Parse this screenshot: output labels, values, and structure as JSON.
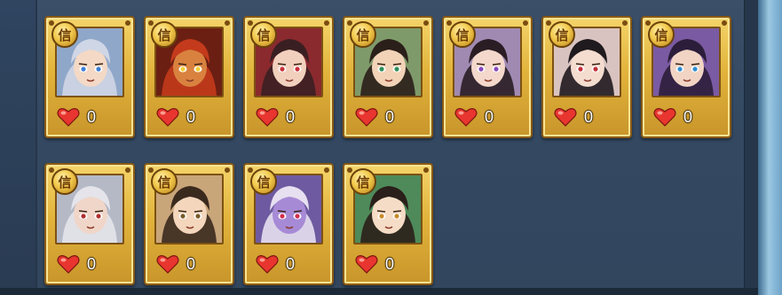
{
  "accent_gold": "#e2b43c",
  "heart_color": "#e8352f",
  "cards": [
    {
      "badge": "信",
      "hair": "#cfd6e6",
      "skin": "#f3d9c6",
      "eyes": "#3f7fd6",
      "bg": "#8fa7c9",
      "count": "0",
      "icon": "white-haired-warrior-portrait"
    },
    {
      "badge": "信",
      "hair": "#c43a1c",
      "skin": "#d9823f",
      "eyes": "#f2d13a",
      "bg": "#6b1f12",
      "count": "0",
      "icon": "red-bearded-warrior-portrait"
    },
    {
      "badge": "信",
      "hair": "#3a1f22",
      "skin": "#f1d0bd",
      "eyes": "#c8323a",
      "bg": "#8a2a2e",
      "count": "0",
      "icon": "red-armored-general-portrait"
    },
    {
      "badge": "信",
      "hair": "#2b1f1a",
      "skin": "#f2d3b8",
      "eyes": "#2f8f5a",
      "bg": "#7f9a6a",
      "count": "0",
      "icon": "dark-haired-woman-portrait"
    },
    {
      "badge": "信",
      "hair": "#2a1d24",
      "skin": "#f3d8cb",
      "eyes": "#8a4bbd",
      "bg": "#a08ab2",
      "count": "0",
      "icon": "circlet-woman-portrait"
    },
    {
      "badge": "信",
      "hair": "#1f1a1e",
      "skin": "#f4dccf",
      "eyes": "#c2303a",
      "bg": "#d9c3c0",
      "count": "0",
      "icon": "crowned-youth-portrait"
    },
    {
      "badge": "信",
      "hair": "#2c1d3a",
      "skin": "#f1d4c4",
      "eyes": "#2f8fd0",
      "bg": "#7a5aa2",
      "count": "0",
      "icon": "purple-helmed-hero-portrait"
    },
    {
      "badge": "信",
      "hair": "#e4e4ea",
      "skin": "#f0d6c8",
      "eyes": "#b03030",
      "bg": "#b5b9c6",
      "count": "0",
      "icon": "silver-haired-sage-portrait"
    },
    {
      "badge": "信",
      "hair": "#3a2a1e",
      "skin": "#f3d6bc",
      "eyes": "#7a5a2a",
      "bg": "#c9a57a",
      "count": "0",
      "icon": "scholar-portrait"
    },
    {
      "badge": "信",
      "hair": "#e6e0f0",
      "skin": "#a78ad6",
      "eyes": "#d03050",
      "bg": "#6e5aa0",
      "count": "0",
      "icon": "demon-masked-portrait"
    },
    {
      "badge": "信",
      "hair": "#2a1f1a",
      "skin": "#f5dcc6",
      "eyes": "#c98a2a",
      "bg": "#4f8a5a",
      "count": "0",
      "icon": "young-girl-portrait"
    }
  ]
}
